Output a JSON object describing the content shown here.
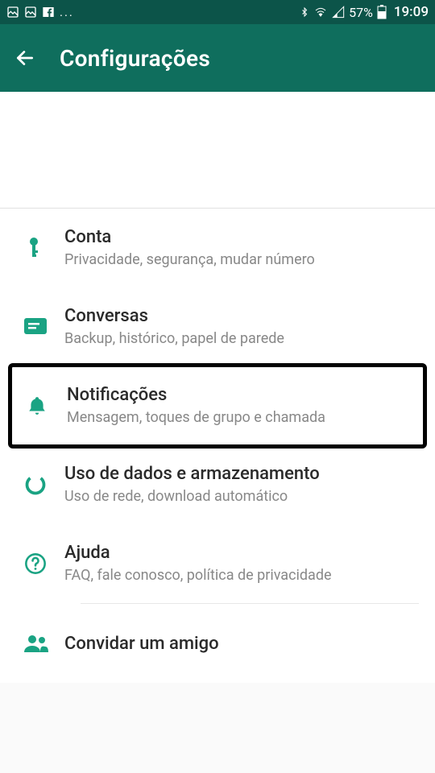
{
  "status": {
    "dots": "...",
    "battery_pct": "57%",
    "time": "19:09"
  },
  "header": {
    "title": "Configurações"
  },
  "settings": [
    {
      "id": "account",
      "icon": "key",
      "title": "Conta",
      "subtitle": "Privacidade, segurança, mudar número"
    },
    {
      "id": "chats",
      "icon": "chat",
      "title": "Conversas",
      "subtitle": "Backup, histórico, papel de parede"
    },
    {
      "id": "notifications",
      "icon": "bell",
      "title": "Notificações",
      "subtitle": "Mensagem, toques de grupo e chamada",
      "highlighted": true
    },
    {
      "id": "data",
      "icon": "data",
      "title": "Uso de dados e armazenamento",
      "subtitle": "Uso de rede, download automático"
    },
    {
      "id": "help",
      "icon": "help",
      "title": "Ajuda",
      "subtitle": "FAQ, fale conosco, política de privacidade"
    },
    {
      "id": "invite",
      "icon": "people",
      "title": "Convidar um amigo",
      "subtitle": ""
    }
  ]
}
